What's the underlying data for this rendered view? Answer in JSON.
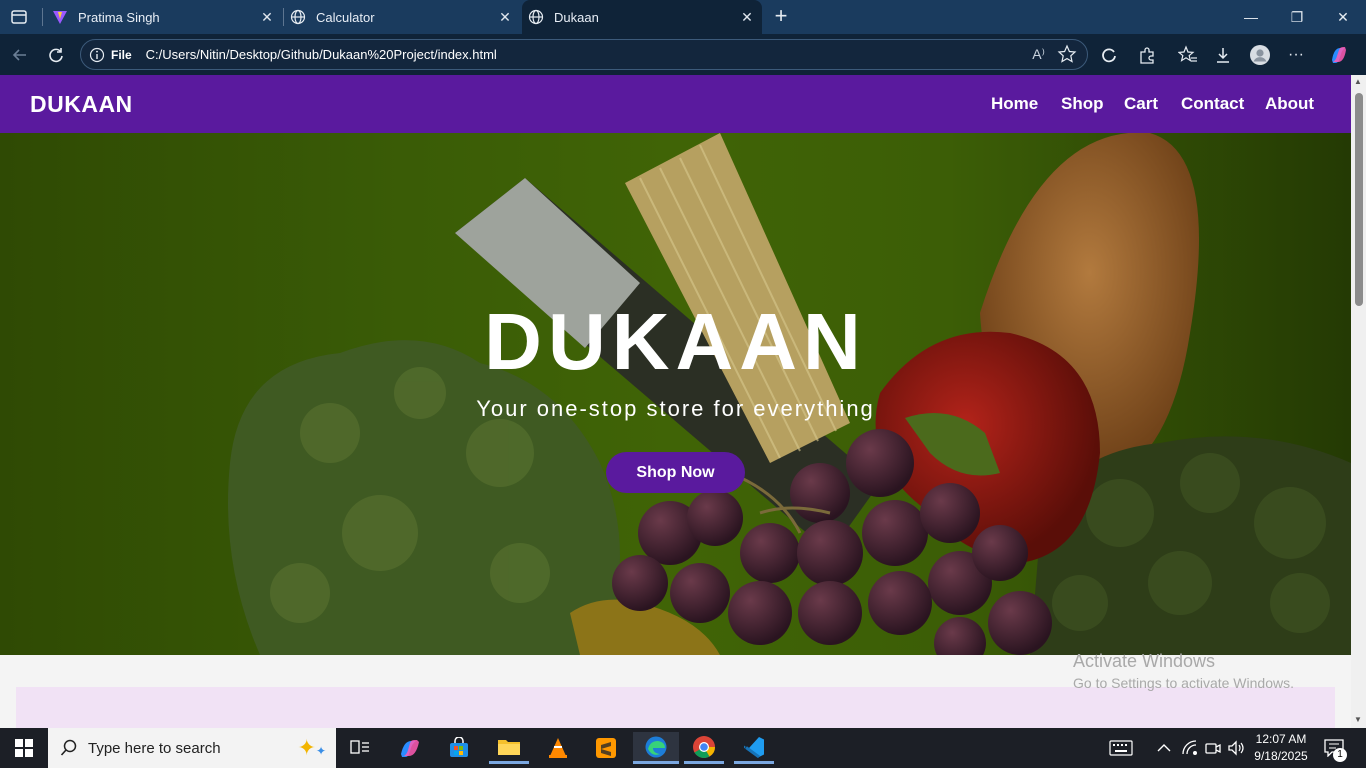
{
  "browser": {
    "tabs": [
      {
        "title": "Pratima Singh",
        "icon": "vite-icon"
      },
      {
        "title": "Calculator",
        "icon": "globe-icon"
      },
      {
        "title": "Dukaan",
        "icon": "globe-icon",
        "active": true
      }
    ],
    "address": {
      "scheme_label": "File",
      "url": "C:/Users/Nitin/Desktop/Github/Dukaan%20Project/index.html"
    }
  },
  "site": {
    "brand": "DUKAAN",
    "nav": [
      "Home",
      "Shop",
      "Cart",
      "Contact",
      "About"
    ],
    "hero": {
      "title": "DUKAAN",
      "subtitle": "Your one-stop store for everything",
      "cta": "Shop Now"
    },
    "colors": {
      "primary": "#5a1a9e",
      "hero_overlay": "#3a5c06",
      "section_bg": "#f1e2f5"
    }
  },
  "watermark": {
    "line1": "Activate Windows",
    "line2": "Go to Settings to activate Windows."
  },
  "taskbar": {
    "search_placeholder": "Type here to search",
    "time": "12:07 AM",
    "date": "9/18/2025",
    "notification_count": "1"
  }
}
